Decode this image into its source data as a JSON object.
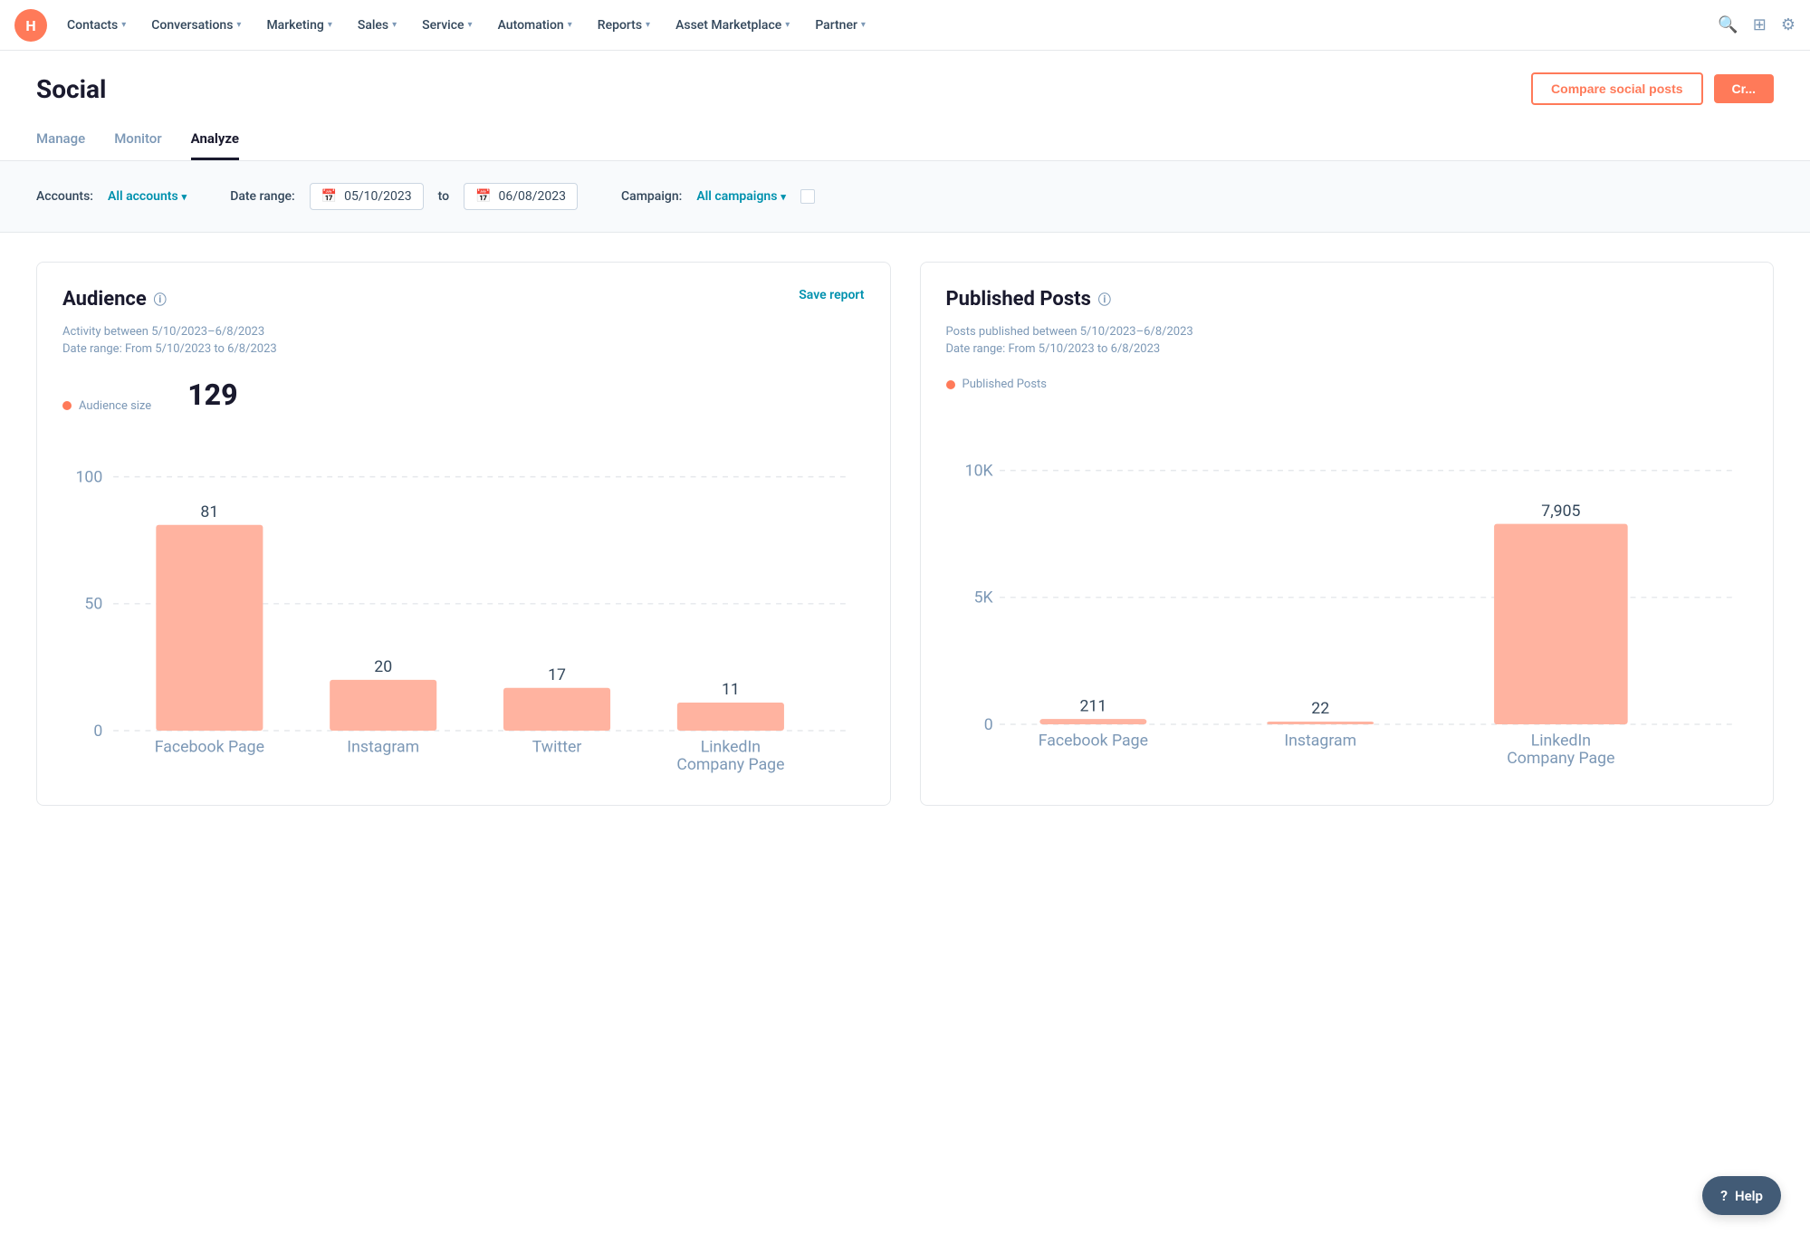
{
  "nav": {
    "logo_alt": "HubSpot Logo",
    "items": [
      {
        "label": "Contacts",
        "has_dropdown": true
      },
      {
        "label": "Conversations",
        "has_dropdown": true
      },
      {
        "label": "Marketing",
        "has_dropdown": true
      },
      {
        "label": "Sales",
        "has_dropdown": true
      },
      {
        "label": "Service",
        "has_dropdown": true
      },
      {
        "label": "Automation",
        "has_dropdown": true
      },
      {
        "label": "Reports",
        "has_dropdown": true
      },
      {
        "label": "Asset Marketplace",
        "has_dropdown": true
      },
      {
        "label": "Partner",
        "has_dropdown": true
      }
    ]
  },
  "page": {
    "title": "Social",
    "compare_button": "Compare social posts",
    "create_button": "Cr...",
    "tabs": [
      {
        "label": "Manage",
        "active": false
      },
      {
        "label": "Monitor",
        "active": false
      },
      {
        "label": "Analyze",
        "active": true
      }
    ]
  },
  "filters": {
    "accounts_label": "Accounts:",
    "accounts_value": "All accounts",
    "date_range_label": "Date range:",
    "date_from": "05/10/2023",
    "date_to_label": "to",
    "date_to": "06/08/2023",
    "campaign_label": "Campaign:",
    "campaign_value": "All campaigns"
  },
  "audience_chart": {
    "title": "Audience",
    "save_report": "Save report",
    "activity_subtitle": "Activity between 5/10/2023–6/8/2023",
    "date_range_meta": "Date range: From 5/10/2023 to 6/8/2023",
    "legend_label": "Audience size",
    "total": "129",
    "bars": [
      {
        "label": "Facebook Page",
        "value": 81,
        "display": "81"
      },
      {
        "label": "Instagram",
        "value": 20,
        "display": "20"
      },
      {
        "label": "Twitter",
        "value": 17,
        "display": "17"
      },
      {
        "label": "LinkedIn\nCompany Page",
        "value": 11,
        "display": "11"
      }
    ],
    "y_axis": [
      "100",
      "50",
      "0"
    ]
  },
  "published_posts_chart": {
    "title": "Published Posts",
    "activity_subtitle": "Posts published between 5/10/2023–6/8/2023",
    "date_range_meta": "Date range: From 5/10/2023 to 6/8/2023",
    "legend_label": "Published Posts",
    "bars": [
      {
        "label": "Facebook Page",
        "value": 211,
        "display": "211"
      },
      {
        "label": "Instagram",
        "value": 22,
        "display": "22"
      },
      {
        "label": "LinkedIn\nCompany Page",
        "value": 7905,
        "display": "7,905"
      }
    ],
    "y_axis": [
      "10K",
      "5K",
      "0"
    ]
  },
  "help": {
    "label": "Help"
  }
}
